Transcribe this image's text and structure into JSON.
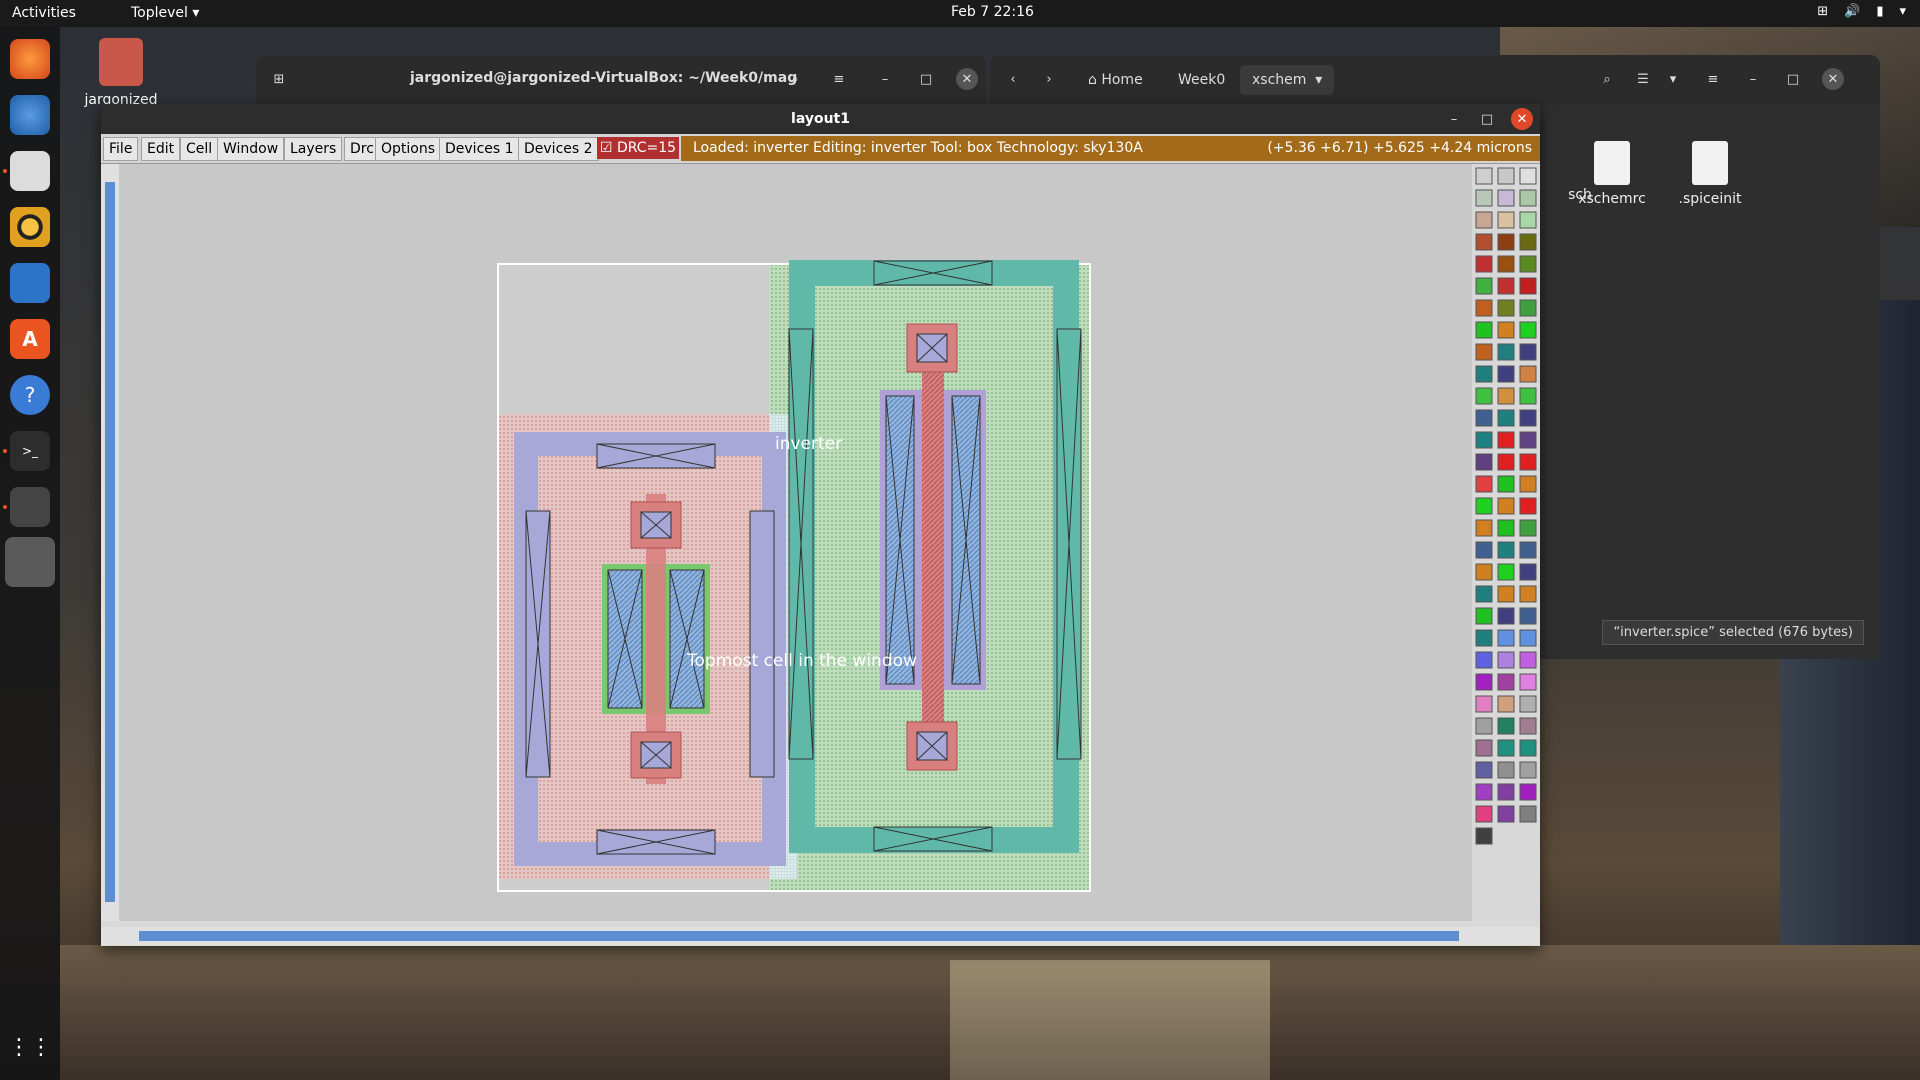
{
  "topbar": {
    "activities": "Activities",
    "app_menu": "Toplevel",
    "clock": "Feb 7  22:16",
    "tray_icons": [
      "network-icon",
      "volume-icon",
      "battery-icon",
      "menu-chevron-icon"
    ]
  },
  "desktop": {
    "home_icon_label": "jargonized"
  },
  "terminal": {
    "title": "jargonized@jargonized-VirtualBox: ~/Week0/mag"
  },
  "files": {
    "breadcrumbs": [
      "Home",
      "Week0",
      "xschem"
    ],
    "items": [
      {
        "label": "sch"
      },
      {
        "label": "xschemrc"
      },
      {
        "label": ".spiceinit"
      }
    ],
    "status": "“inverter.spice” selected  (676 bytes)"
  },
  "magic": {
    "title": "layout1",
    "menu": [
      "File",
      "Edit",
      "Cell",
      "Window",
      "Layers",
      "Drc",
      "Options",
      "Devices 1",
      "Devices 2"
    ],
    "drc_label": "DRC=15",
    "status_message": "Loaded: inverter Editing: inverter Tool: box  Technology: sky130A",
    "coords": "(+5.36 +6.71) +5.625 +4.24 microns",
    "cell_label": "inverter",
    "topmost_label": "Topmost cell in the window"
  }
}
